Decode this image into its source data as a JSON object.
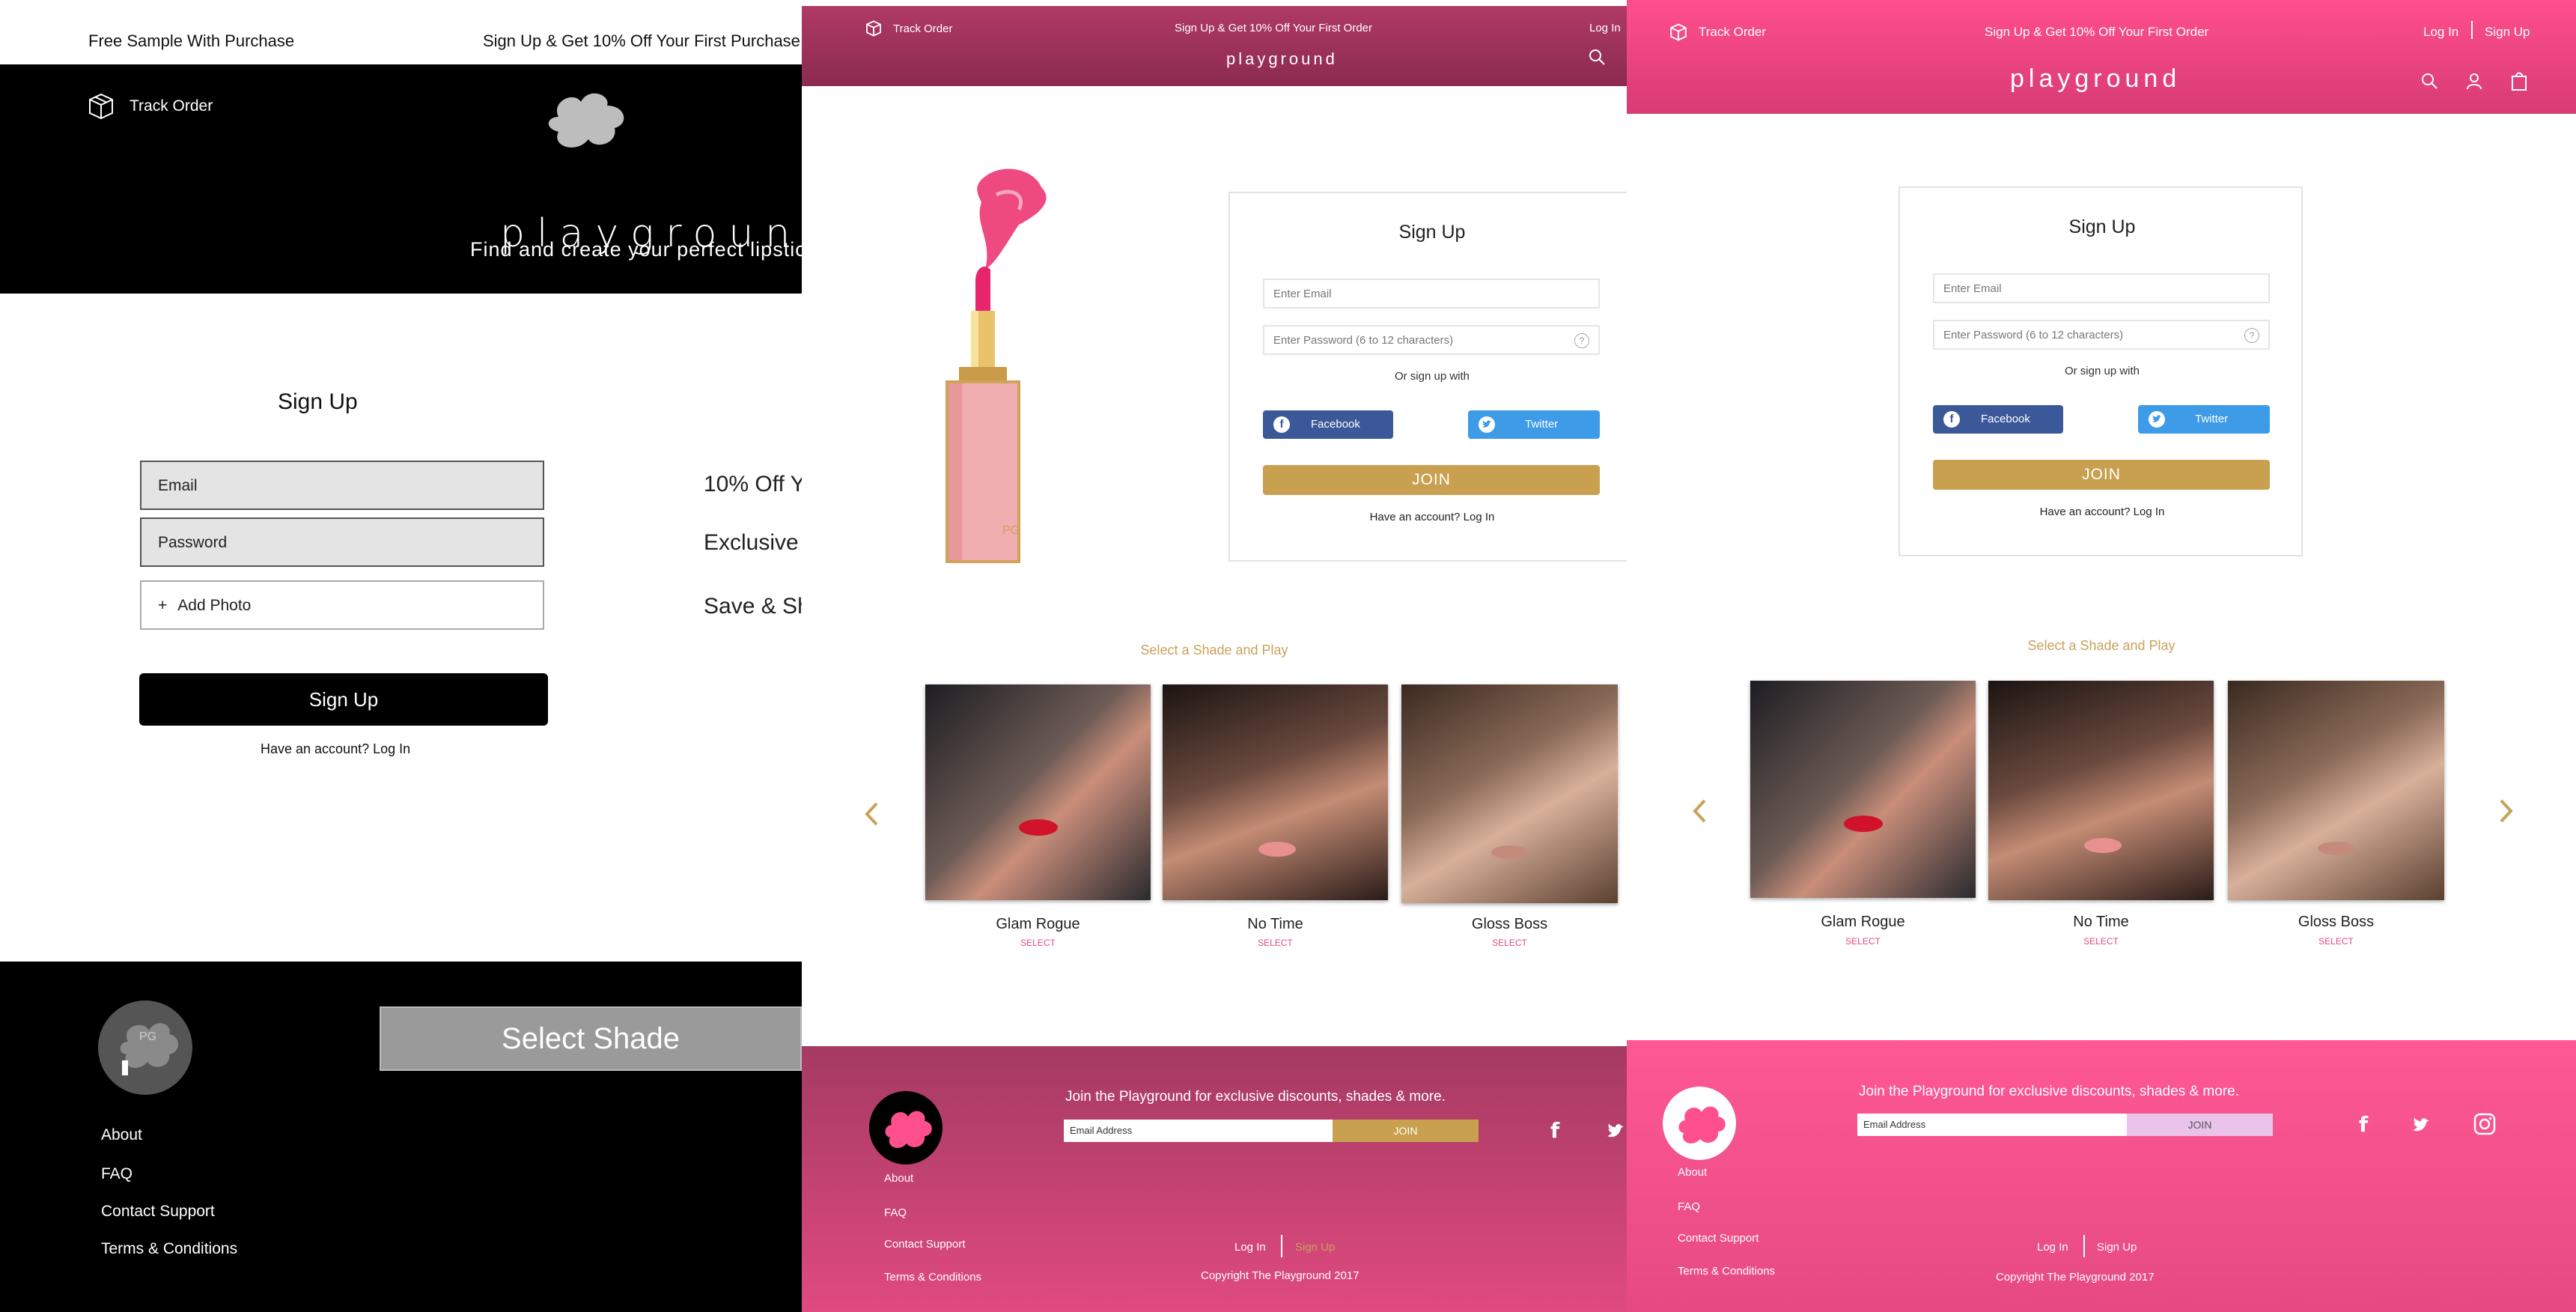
{
  "panel1": {
    "promo_left": "Free Sample With Purchase",
    "promo_right": "Sign Up & Get 10% Off Your First Purchase",
    "track_order": "Track Order",
    "logo_text": "playground",
    "tagline": "Find and create your perfect lipstick",
    "signup_title": "Sign Up",
    "email_placeholder": "Email",
    "password_placeholder": "Password",
    "add_photo": "Add Photo",
    "add_photo_plus": "+",
    "signup_button": "Sign Up",
    "have_account": "Have an account? Log In",
    "benefits": [
      "10% Off Y",
      "Exclusive",
      "Save & Sh"
    ],
    "select_shade": "Select Shade",
    "footer_links": [
      "About",
      "FAQ",
      "Contact Support",
      "Terms & Conditions"
    ],
    "footer_logo_text": "PG"
  },
  "panel2": {
    "track_order": "Track Order",
    "promo": "Sign Up & Get 10% Off Your First Order",
    "login": "Log In",
    "logo_text": "playground",
    "signup_title": "Sign Up",
    "email_placeholder": "Enter Email",
    "password_placeholder": "Enter Password (6 to 12 characters)",
    "help_glyph": "?",
    "or_signup": "Or sign up with",
    "facebook": "Facebook",
    "twitter": "Twitter",
    "join": "JOIN",
    "have_account": "Have an account? Log In",
    "lipstick_brand": "PG",
    "section_title": "Select a Shade and Play",
    "shades": [
      {
        "name": "Glam Rogue",
        "select": "SELECT"
      },
      {
        "name": "No Time",
        "select": "SELECT"
      },
      {
        "name": "Gloss Boss",
        "select": "SELECT"
      }
    ],
    "newsletter": "Join the Playground for exclusive discounts, shades & more.",
    "email_address": "Email Address",
    "newsletter_join": "JOIN",
    "footer_links": [
      "About",
      "FAQ",
      "Contact Support",
      "Terms & Conditions"
    ],
    "footer_login": "Log In",
    "footer_signup": "Sign Up",
    "copyright": "Copyright The Playground 2017"
  },
  "panel3": {
    "track_order": "Track Order",
    "promo": "Sign Up & Get 10% Off Your First Order",
    "login": "Log In",
    "signup": "Sign Up",
    "logo_text": "playground",
    "signup_title": "Sign Up",
    "email_placeholder": "Enter Email",
    "password_placeholder": "Enter Password (6 to 12 characters)",
    "help_glyph": "?",
    "or_signup": "Or sign up with",
    "facebook": "Facebook",
    "twitter": "Twitter",
    "join": "JOIN",
    "have_account": "Have an account? Log In",
    "section_title": "Select a Shade and Play",
    "shades": [
      {
        "name": "Glam Rogue",
        "select": "SELECT"
      },
      {
        "name": "No Time",
        "select": "SELECT"
      },
      {
        "name": "Gloss Boss",
        "select": "SELECT"
      }
    ],
    "newsletter": "Join the Playground for exclusive discounts, shades & more.",
    "email_address": "Email Address",
    "newsletter_join": "JOIN",
    "footer_links": [
      "About",
      "FAQ",
      "Contact Support",
      "Terms & Conditions"
    ],
    "footer_login": "Log In",
    "footer_signup": "Sign Up",
    "copyright": "Copyright The Playground 2017"
  },
  "colors": {
    "brand_pink": "#ff4f8d",
    "dark_pink": "#8b2a4e",
    "gold": "#c9a25a",
    "facebook": "#3b5998",
    "twitter": "#3d9be8",
    "newsletter_join_pink": "#e9c3ea"
  }
}
